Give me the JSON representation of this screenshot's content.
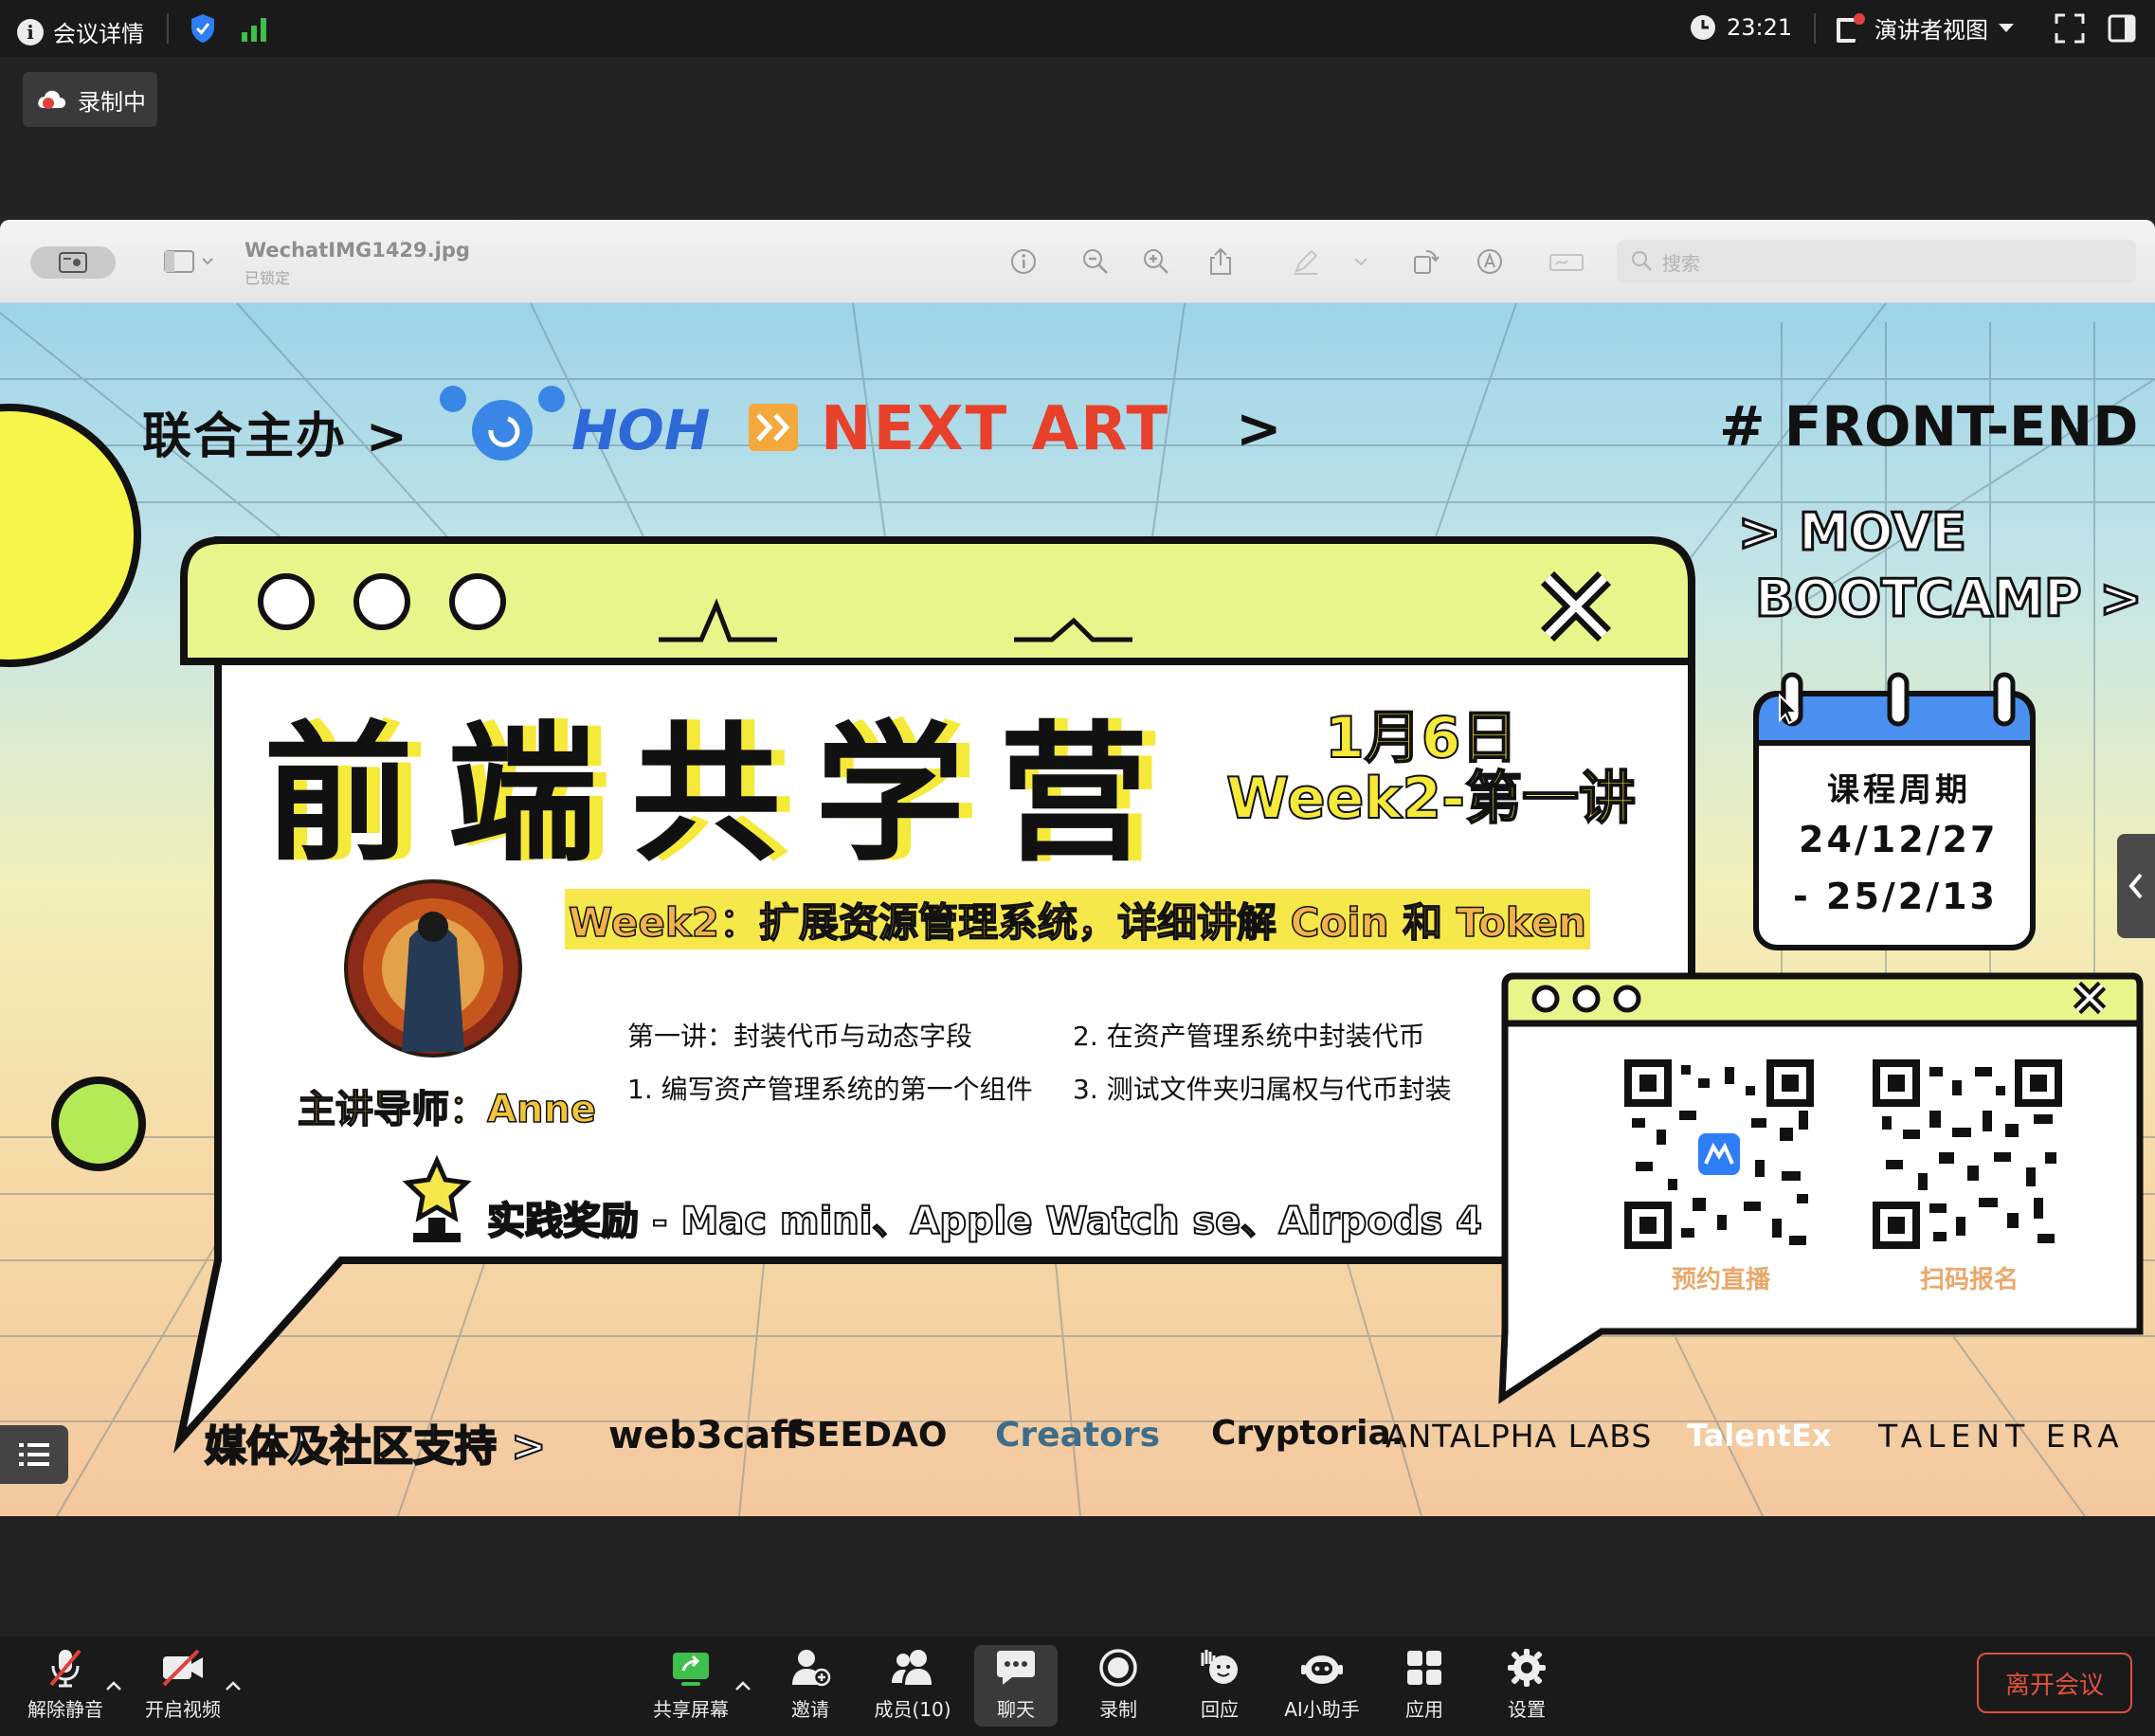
{
  "topbar": {
    "meeting_details": "会议详情",
    "time": "23:21",
    "view_mode": "演讲者视图"
  },
  "recording_badge": "录制中",
  "viewer": {
    "filename": "WechatIMG1429.jpg",
    "locked": "已锁定",
    "search_placeholder": "搜索"
  },
  "slide": {
    "co_host_label": "联合主办 >",
    "partner1": "HOH",
    "partner2": "NEXT ART",
    "arrow": ">",
    "tag_frontend": "# FRONT-END",
    "tag_move": "> MOVE",
    "tag_bootcamp": "BOOTCAMP >",
    "main_title": "前端共学营",
    "date": "1月6日",
    "week": "Week2-第一讲",
    "calendar_title": "课程周期",
    "calendar_start": "24/12/27",
    "calendar_end": "- 25/2/13",
    "subtitle": "Week2：扩展资源管理系统，详细讲解 Coin 和 Token",
    "lectures": [
      "第一讲：封装代币与动态字段",
      "2. 在资产管理系统中封装代币",
      "1. 编写资产管理系统的第一个组件",
      "3. 测试文件夹归属权与代币封装"
    ],
    "instructor": "主讲导师：Anne",
    "reward": "实践奖励 - Mac mini、Apple Watch se、Airpods 4",
    "qr1_label": "预约直播",
    "qr2_label": "扫码报名",
    "media_label": "媒体及社区支持 >",
    "sponsors": [
      "web3caff",
      "SEEDAO",
      "Creators",
      "Cryptoria.",
      "ANTALPHA LABS",
      "TalentEx",
      "TALENT ERA"
    ]
  },
  "bottombar": {
    "unmute": "解除静音",
    "start_video": "开启视频",
    "share_screen": "共享屏幕",
    "invite": "邀请",
    "members": "成员(10)",
    "chat": "聊天",
    "record": "录制",
    "reactions": "回应",
    "ai_assistant": "AI小助手",
    "apps": "应用",
    "settings": "设置",
    "leave": "离开会议"
  },
  "colors": {
    "leave": "#e0513f",
    "accent_blue": "#2d7ef7",
    "slide_yellow": "#f6f64a",
    "title_shadow": "#f5e93a"
  }
}
